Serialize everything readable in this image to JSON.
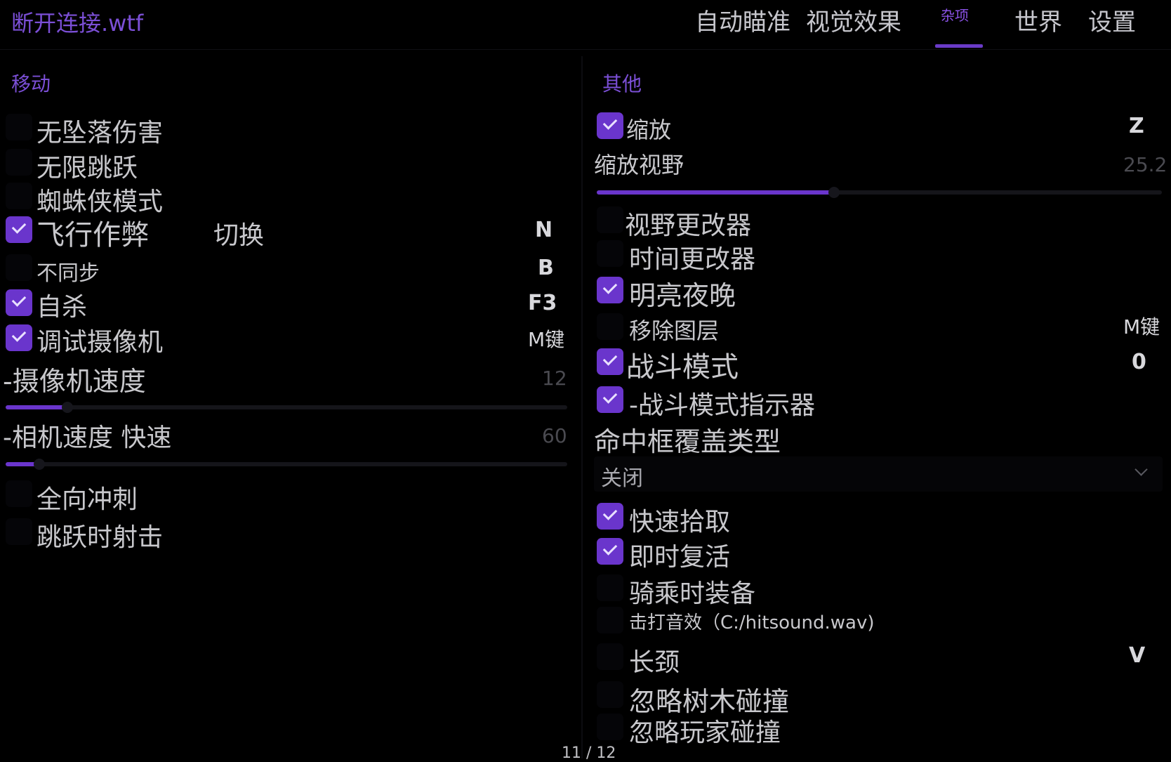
{
  "app_title": "断开连接.wtf",
  "nav": {
    "tabs": [
      "自动瞄准",
      "视觉效果",
      "杂项",
      "世界",
      "设置"
    ]
  },
  "movement": {
    "title": "移动",
    "no_fall_damage": "无坠落伤害",
    "infinite_jump": "无限跳跃",
    "spider_mode": "蜘蛛侠模式",
    "fly_hack": "飞行作弊",
    "fly_mode": "切换",
    "fly_key": "N",
    "desync": "不同步",
    "desync_key": "B",
    "suicide": "自杀",
    "suicide_key": "F3",
    "debug_camera": "调试摄像机",
    "debug_camera_key": "M键",
    "camera_speed_label": "-摄像机速度",
    "camera_speed_value": "12",
    "camera_speed_fraction": 0.11,
    "camera_fast_label": "-相机速度 快速",
    "camera_fast_value": "60",
    "camera_fast_fraction": 0.06,
    "omni_sprint": "全向冲刺",
    "jump_shoot": "跳跃时射击"
  },
  "other": {
    "title": "其他",
    "zoom": "缩放",
    "zoom_key": "Z",
    "zoom_fov_label": "缩放视野",
    "zoom_fov_value": "25.2",
    "zoom_fov_fraction": 0.42,
    "fov_changer": "视野更改器",
    "time_changer": "时间更改器",
    "bright_night": "明亮夜晚",
    "remove_layers": "移除图层",
    "remove_layers_key": "M键",
    "combat_mode": "战斗模式",
    "combat_mode_key": "0",
    "combat_indicator": "-战斗模式指示器",
    "hitbox_label": "命中框覆盖类型",
    "hitbox_value": "关闭",
    "fast_loot": "快速拾取",
    "instant_revive": "即时复活",
    "equip_mounted": "骑乘时装备",
    "hitsound": "击打音效（C:/hitsound.wav)",
    "long_neck": "长颈",
    "long_neck_key": "V",
    "ignore_tree": "忽略树木碰撞",
    "ignore_player": "忽略玩家碰撞"
  },
  "page_counter": "11 / 12",
  "colors": {
    "accent": "#6a35cc",
    "title": "#7b4fd6",
    "background": "#000000"
  }
}
